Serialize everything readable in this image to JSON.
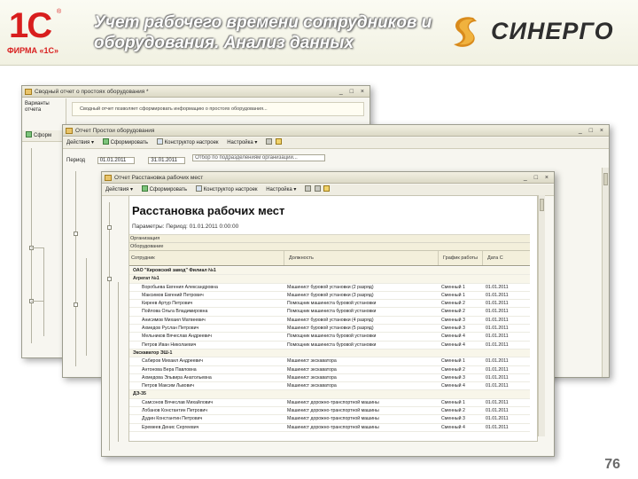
{
  "header": {
    "logo_1c_mark": "1С",
    "logo_1c_firm": "ФИРМА «1С»",
    "logo_1c_reg": "®",
    "title_line1": "Учет рабочего времени сотрудников и",
    "title_line2": "оборудования. Анализ данных",
    "brand_name": "СИНЕРГО"
  },
  "window1": {
    "title": "Сводный отчет о простоях оборудования *",
    "side_label": "Варианты отчета",
    "description": "Сводный отчет позволяет сформировать информацию о простоях оборудования...",
    "toolbar_item": "Сформ"
  },
  "window2": {
    "title": "Отчет   Простои оборудования",
    "toolbar": [
      "Действия",
      "Сформировать",
      "Конструктор настроек",
      "Настройка"
    ],
    "period_label": "Период",
    "date_from": "01.01.2011",
    "date_to": "31.01.2011",
    "query_text": "Отбор по подразделениям организации..."
  },
  "window3": {
    "title": "Отчет   Расстановка рабочих мест",
    "toolbar": [
      "Действия",
      "Сформировать",
      "Конструктор настроек",
      "Настройка"
    ],
    "report_title": "Расстановка рабочих мест",
    "params": "Параметры:     Период: 01.01.2011 0:00:00",
    "header_rows": [
      "Организация",
      "Оборудование",
      "Сотрудник"
    ],
    "columns": [
      "Сотрудник",
      "Должность",
      "График работы",
      "Дата С"
    ],
    "rows": [
      {
        "g": true,
        "name": "ОАО \"Кировский завод\" Филиал №1",
        "pos": "",
        "sch": "",
        "date": ""
      },
      {
        "g": true,
        "name": "Агрегат №1",
        "pos": "",
        "sch": "",
        "date": ""
      },
      {
        "g": false,
        "name": "Воробьева Евгения Александровна",
        "pos": "Машинист буровой установки (2 разряд)",
        "sch": "Сменный 1",
        "date": "01.01.2011"
      },
      {
        "g": false,
        "name": "Максимов Евгений Петрович",
        "pos": "Машинист буровой установки (3 разряд)",
        "sch": "Сменный 1",
        "date": "01.01.2011"
      },
      {
        "g": false,
        "name": "Киреев Артур Петрович",
        "pos": "Помощник машиниста буровой установки",
        "sch": "Сменный 2",
        "date": "01.01.2011"
      },
      {
        "g": false,
        "name": "Пойлова Ольга Владимировна",
        "pos": "Помощник машиниста буровой установки",
        "sch": "Сменный 2",
        "date": "01.01.2011"
      },
      {
        "g": false,
        "name": "Анисимов Михаил Матвеевич",
        "pos": "Машинист буровой установки (4 разряд)",
        "sch": "Сменный 3",
        "date": "01.01.2011"
      },
      {
        "g": false,
        "name": "Ахмедов Руслан Петрович",
        "pos": "Машинист буровой установки (5 разряд)",
        "sch": "Сменный 3",
        "date": "01.01.2011"
      },
      {
        "g": false,
        "name": "Мельников Вячеслав Андреевич",
        "pos": "Помощник машиниста буровой установки",
        "sch": "Сменный 4",
        "date": "01.01.2011"
      },
      {
        "g": false,
        "name": "Петров Иван Николаевич",
        "pos": "Помощник машиниста буровой установки",
        "sch": "Сменный 4",
        "date": "01.01.2011"
      },
      {
        "g": true,
        "name": "Экскаватор ЭШ-1",
        "pos": "",
        "sch": "",
        "date": ""
      },
      {
        "g": false,
        "name": "Сабиров Михаил Андреевич",
        "pos": "Машинист экскаватора",
        "sch": "Сменный 1",
        "date": "01.01.2011"
      },
      {
        "g": false,
        "name": "Антонова Вера Павловна",
        "pos": "Машинист экскаватора",
        "sch": "Сменный 2",
        "date": "01.01.2011"
      },
      {
        "g": false,
        "name": "Ахмедова Эльвира Анатольевна",
        "pos": "Машинист экскаватора",
        "sch": "Сменный 3",
        "date": "01.01.2011"
      },
      {
        "g": false,
        "name": "Петров Максим Львович",
        "pos": "Машинист экскаватора",
        "sch": "Сменный 4",
        "date": "01.01.2011"
      },
      {
        "g": true,
        "name": "ДЭ-35",
        "pos": "",
        "sch": "",
        "date": ""
      },
      {
        "g": false,
        "name": "Самсонов Вячеслав Михайлович",
        "pos": "Машинист дорожно-транспортной машины",
        "sch": "Сменный 1",
        "date": "01.01.2011"
      },
      {
        "g": false,
        "name": "Лобанов Константин Петрович",
        "pos": "Машинист дорожно-транспортной машины",
        "sch": "Сменный 2",
        "date": "01.01.2011"
      },
      {
        "g": false,
        "name": "Дудин Константин Петрович",
        "pos": "Машинист дорожно-транспортной машины",
        "sch": "Сменный 3",
        "date": "01.01.2011"
      },
      {
        "g": false,
        "name": "Еремеев Денис Сергеевич",
        "pos": "Машинист дорожно-транспортной машины",
        "sch": "Сменный 4",
        "date": "01.01.2011"
      }
    ]
  },
  "slide_number": "76"
}
